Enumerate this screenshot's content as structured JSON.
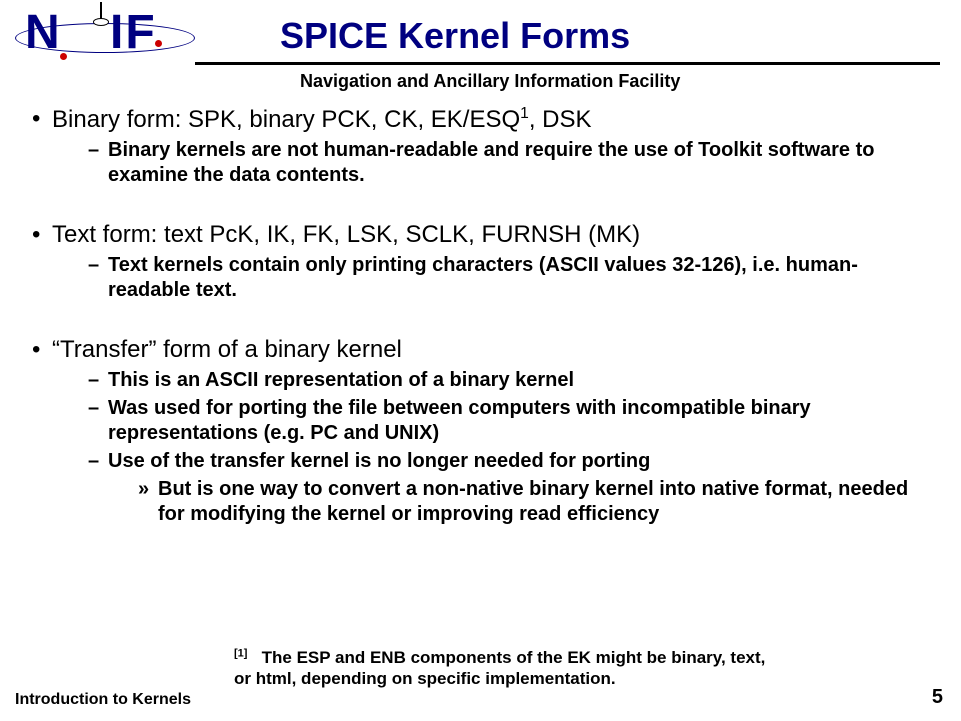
{
  "header": {
    "logo_n": "N",
    "logo_if": "IF",
    "title": "SPICE Kernel Forms",
    "subtitle": "Navigation and Ancillary Information Facility"
  },
  "content": {
    "b1": {
      "title_pre": "Binary form: SPK, binary PCK, CK, EK/ESQ",
      "title_sup": "1",
      "title_post": ", DSK",
      "sub1": "Binary kernels are not human-readable and require the use of Toolkit software to examine the data contents."
    },
    "b2": {
      "title": "Text form: text PcK, IK, FK, LSK, SCLK, FURNSH (MK)",
      "sub1": "Text kernels contain only printing characters (ASCII values 32-126), i.e. human-readable text."
    },
    "b3": {
      "title": "“Transfer” form of a binary kernel",
      "sub1": "This is an ASCII representation of a binary kernel",
      "sub2": "Was used for porting the file between computers with incompatible binary representations (e.g. PC and UNIX)",
      "sub3": "Use of the transfer kernel is no longer needed for porting",
      "sub3a": "But is one way to convert a non-native binary kernel into native format, needed for modifying the kernel or improving read efficiency"
    }
  },
  "footnote": {
    "ref": "[1]",
    "text": "The ESP and ENB components of the EK might be binary, text, or html, depending on specific implementation."
  },
  "footer": {
    "left": "Introduction to Kernels",
    "right": "5"
  }
}
